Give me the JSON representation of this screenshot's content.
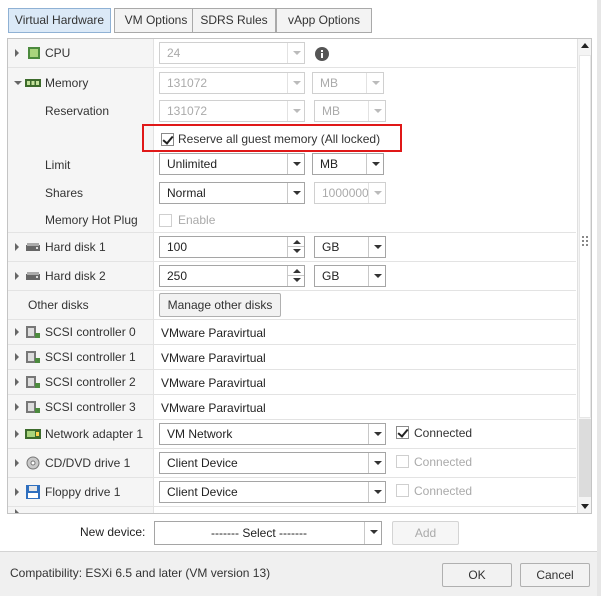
{
  "tabs": [
    {
      "label": "Virtual Hardware",
      "active": true
    },
    {
      "label": "VM Options",
      "active": false
    },
    {
      "label": "SDRS Rules",
      "active": false
    },
    {
      "label": "vApp Options",
      "active": false
    }
  ],
  "cpu": {
    "label": "CPU",
    "value": "24",
    "info_icon": "info-icon"
  },
  "memory": {
    "label": "Memory",
    "value": "131072",
    "unit": "MB",
    "reservation": {
      "label": "Reservation",
      "value": "131072",
      "unit": "MB"
    },
    "reserve_all": {
      "label": "Reserve all guest memory (All locked)",
      "checked": true
    },
    "limit": {
      "label": "Limit",
      "value": "Unlimited",
      "unit": "MB"
    },
    "shares": {
      "label": "Shares",
      "value": "Normal",
      "count": "1000000"
    },
    "hot_plug": {
      "label": "Memory Hot Plug",
      "enable_label": "Enable",
      "checked": false
    }
  },
  "hard_disks": [
    {
      "label": "Hard disk 1",
      "value": "100",
      "unit": "GB"
    },
    {
      "label": "Hard disk 2",
      "value": "250",
      "unit": "GB"
    }
  ],
  "other_disks": {
    "label": "Other disks",
    "button": "Manage other disks"
  },
  "scsi_controllers": [
    {
      "label": "SCSI controller 0",
      "value": "VMware Paravirtual"
    },
    {
      "label": "SCSI controller 1",
      "value": "VMware Paravirtual"
    },
    {
      "label": "SCSI controller 2",
      "value": "VMware Paravirtual"
    },
    {
      "label": "SCSI controller 3",
      "value": "VMware Paravirtual"
    }
  ],
  "network_adapter": {
    "label": "Network adapter 1",
    "value": "VM Network",
    "connected_label": "Connected",
    "connected": true
  },
  "cd_dvd": {
    "label": "CD/DVD drive 1",
    "value": "Client Device",
    "connected_label": "Connected",
    "connected": false
  },
  "floppy": {
    "label": "Floppy drive 1",
    "value": "Client Device",
    "connected_label": "Connected",
    "connected": false
  },
  "new_device": {
    "label": "New device:",
    "value": "------- Select -------",
    "add_label": "Add"
  },
  "footer": {
    "compatibility": "Compatibility: ESXi 6.5 and later (VM version 13)",
    "ok_label": "OK",
    "cancel_label": "Cancel"
  },
  "colors": {
    "highlight": "#e01818",
    "active_tab": "#dbe9f7",
    "label_column": "#f5f5f5"
  }
}
